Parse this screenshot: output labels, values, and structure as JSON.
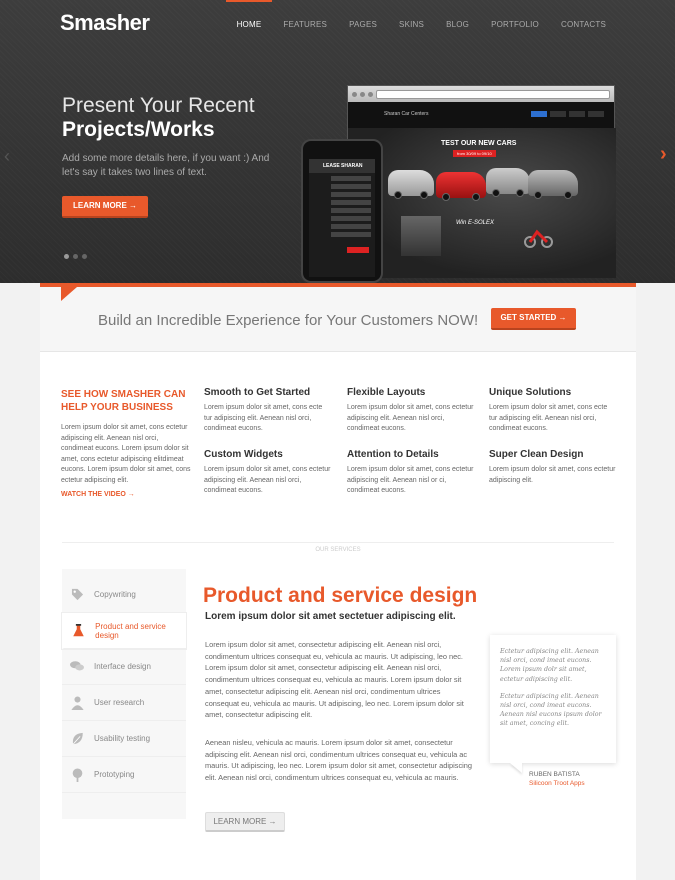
{
  "header": {
    "logo": "Smasher",
    "nav": [
      "HOME",
      "FEATURES",
      "PAGES",
      "SKINS",
      "BLOG",
      "PORTFOLIO",
      "CONTACTS"
    ]
  },
  "hero": {
    "title_line1": "Present Your Recent",
    "title_line2": "Projects/Works",
    "description": "Add some more details here, if you want :) And let's say it takes two lines of text.",
    "button": "LEARN MORE →",
    "arrow_left": "‹",
    "arrow_right": "›",
    "mockup": {
      "site_brand": "Sharan Car Centers",
      "headline": "TEST OUR NEW CARS",
      "subline": "from 30/09 to 09/10",
      "promo": "Win E-SOLEX",
      "phone_title": "LEASE SHARAN"
    }
  },
  "callout": {
    "text": "Build an Incredible Experience for Your Customers NOW!",
    "button": "GET STARTED →"
  },
  "intro": {
    "title": "SEE HOW SMASHER CAN HELP YOUR BUSINESS",
    "text": "Lorem ipsum dolor sit amet, cons ectetur adipiscing elit. Aenean nisl orci, condimeat eucons. Lorem ipsum dolor sit amet, cons ectetur adipiscing elitdimeat eucons. Lorem ipsum dolor sit amet, cons ectetur adipiscing elit.",
    "link": "WATCH THE VIDEO →"
  },
  "features": [
    {
      "title": "Smooth to Get Started",
      "text": "Lorem ipsum dolor sit amet, cons ecte tur adipiscing elit. Aenean nisl orci, condimeat eucons."
    },
    {
      "title": "Flexible Layouts",
      "text": "Lorem ipsum dolor sit amet, cons ectetur adipiscing elit. Aenean nisl orci, condimeat eucons."
    },
    {
      "title": "Unique Solutions",
      "text": "Lorem ipsum dolor sit amet, cons ecte tur adipiscing elit. Aenean nisl orci, condimeat eucons."
    },
    {
      "title": "Custom Widgets",
      "text": "Lorem ipsum dolor sit amet, cons ectetur adipiscing elit. Aenean nisl orci, condimeat eucons."
    },
    {
      "title": "Attention to Details",
      "text": "Lorem ipsum dolor sit amet, cons ectetur adipiscing elit. Aenean nisl or ci, condimeat eucons."
    },
    {
      "title": "Super Clean Design",
      "text": "Lorem ipsum dolor sit amet, cons ectetur adipiscing elit."
    }
  ],
  "divider_label": "OUR SERVICES",
  "services": {
    "tabs": [
      {
        "label": "Copywriting",
        "icon": "tag-icon"
      },
      {
        "label": "Product and service design",
        "icon": "flask-icon"
      },
      {
        "label": "Interface design",
        "icon": "chat-bubbles-icon"
      },
      {
        "label": "User research",
        "icon": "user-icon"
      },
      {
        "label": "Usability testing",
        "icon": "leaf-icon"
      },
      {
        "label": "Prototyping",
        "icon": "tree-icon"
      }
    ],
    "active_index": 1,
    "title": "Product and service design",
    "subtitle": "Lorem ipsum dolor sit amet sectetuer adipiscing elit.",
    "paragraph1": "Lorem ipsum dolor sit amet, consectetur adipiscing elit. Aenean nisl orci, condimentum ultrices consequat eu, vehicula ac mauris. Ut adipiscing, leo nec. Lorem ipsum dolor sit amet, consectetur adipiscing elit. Aenean nisl orci, condimentum ultrices consequat eu, vehicula ac mauris. Lorem ipsum dolor sit amet, consectetur adipiscing elit. Aenean nisl orci, condimentum ultrices consequat eu, vehicula ac mauris. Ut adipiscing, leo nec. Lorem ipsum dolor sit amet, consectetur adipiscing elit.",
    "paragraph2": "Aenean nisleu, vehicula ac mauris.  Lorem ipsum dolor sit amet, consectetur adipiscing elit. Aenean nisl orci, condimentum ultrices consequat eu, vehicula ac mauris. Ut adipiscing, leo nec. Lorem ipsum dolor sit amet, consectetur adipiscing elit. Aenean nisl orci, condimentum ultrices consequat eu, vehicula ac mauris.",
    "button": "LEARN MORE →",
    "quote_p1": "Ectetur adipiscing elit. Aenean nisl orci, cond imeat eucons. Lorem ipsum dolr sit amet, ectetur adipiscing elit.",
    "quote_p2": "Ectetur adipiscing elit. Aenean nisl orci, cond imeat eucons. Aenean nisl eucons ipsum dolor sit amet, concing elit.",
    "quote_author": "RUBEN BATISTA",
    "quote_company": "Silicoon Troot Apps"
  },
  "colors": {
    "accent": "#e8592b",
    "hero_bg": "#3a3a3a",
    "page_bg": "#f2f2f2"
  }
}
